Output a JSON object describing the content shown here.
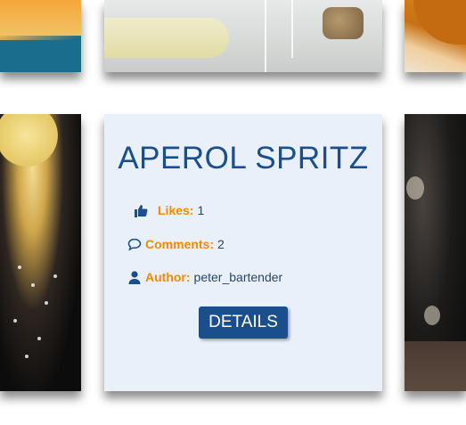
{
  "card": {
    "title": "APEROL SPRITZ",
    "likes_label": "Likes:",
    "likes_value": "1",
    "comments_label": "Comments:",
    "comments_value": "2",
    "author_label": "Author:",
    "author_value": "peter_bartender",
    "details_label": "DETAILS",
    "icons": [
      "thumbs-up-icon",
      "comment-icon",
      "user-icon"
    ]
  },
  "colors": {
    "title": "#1b4e8c",
    "label_accent": "#f08a00",
    "card_background": "#e9f0f9",
    "button_background": "#1b4e8c"
  }
}
